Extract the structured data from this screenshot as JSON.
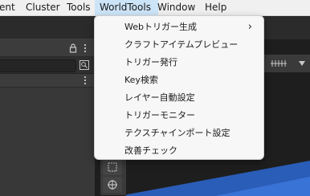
{
  "menubar": {
    "items": [
      {
        "label": "ent",
        "active": false
      },
      {
        "label": "Cluster",
        "active": false
      },
      {
        "label": "Tools",
        "active": false
      },
      {
        "label": "WorldTools",
        "active": true
      },
      {
        "label": "Window",
        "active": false
      },
      {
        "label": "Help",
        "active": false
      }
    ]
  },
  "panel": {
    "header_icons": [
      "lock-icon",
      "more-icon"
    ],
    "toolbar_icons": [
      "search-button-icon"
    ],
    "subheader_icons": [
      "more-icon"
    ]
  },
  "scene": {
    "toolbar_icons": [
      "grid-icon",
      "dropdown-arrow-icon"
    ],
    "tool_icons": [
      "rect-tool-icon",
      "transform-tool-icon"
    ]
  },
  "dropdown": {
    "items": [
      {
        "label": "Webトリガー生成",
        "has_submenu": true
      },
      {
        "label": "クラフトアイテムプレビュー",
        "has_submenu": false
      },
      {
        "label": "トリガー発行",
        "has_submenu": false
      },
      {
        "label": "Key検索",
        "has_submenu": false
      },
      {
        "label": "レイヤー自動設定",
        "has_submenu": false
      },
      {
        "label": "トリガーモニター",
        "has_submenu": false
      },
      {
        "label": "テクスチャインポート設定",
        "has_submenu": false
      },
      {
        "label": "改善チェック",
        "has_submenu": false
      }
    ],
    "submenu_arrow": "›"
  },
  "colors": {
    "menubar_bg": "#f0f0f0",
    "menu_active": "#cce4f7",
    "dropdown_bg": "#f7f7f7",
    "editor_dark": "#383838",
    "scene_blue": "#2a5db8"
  }
}
